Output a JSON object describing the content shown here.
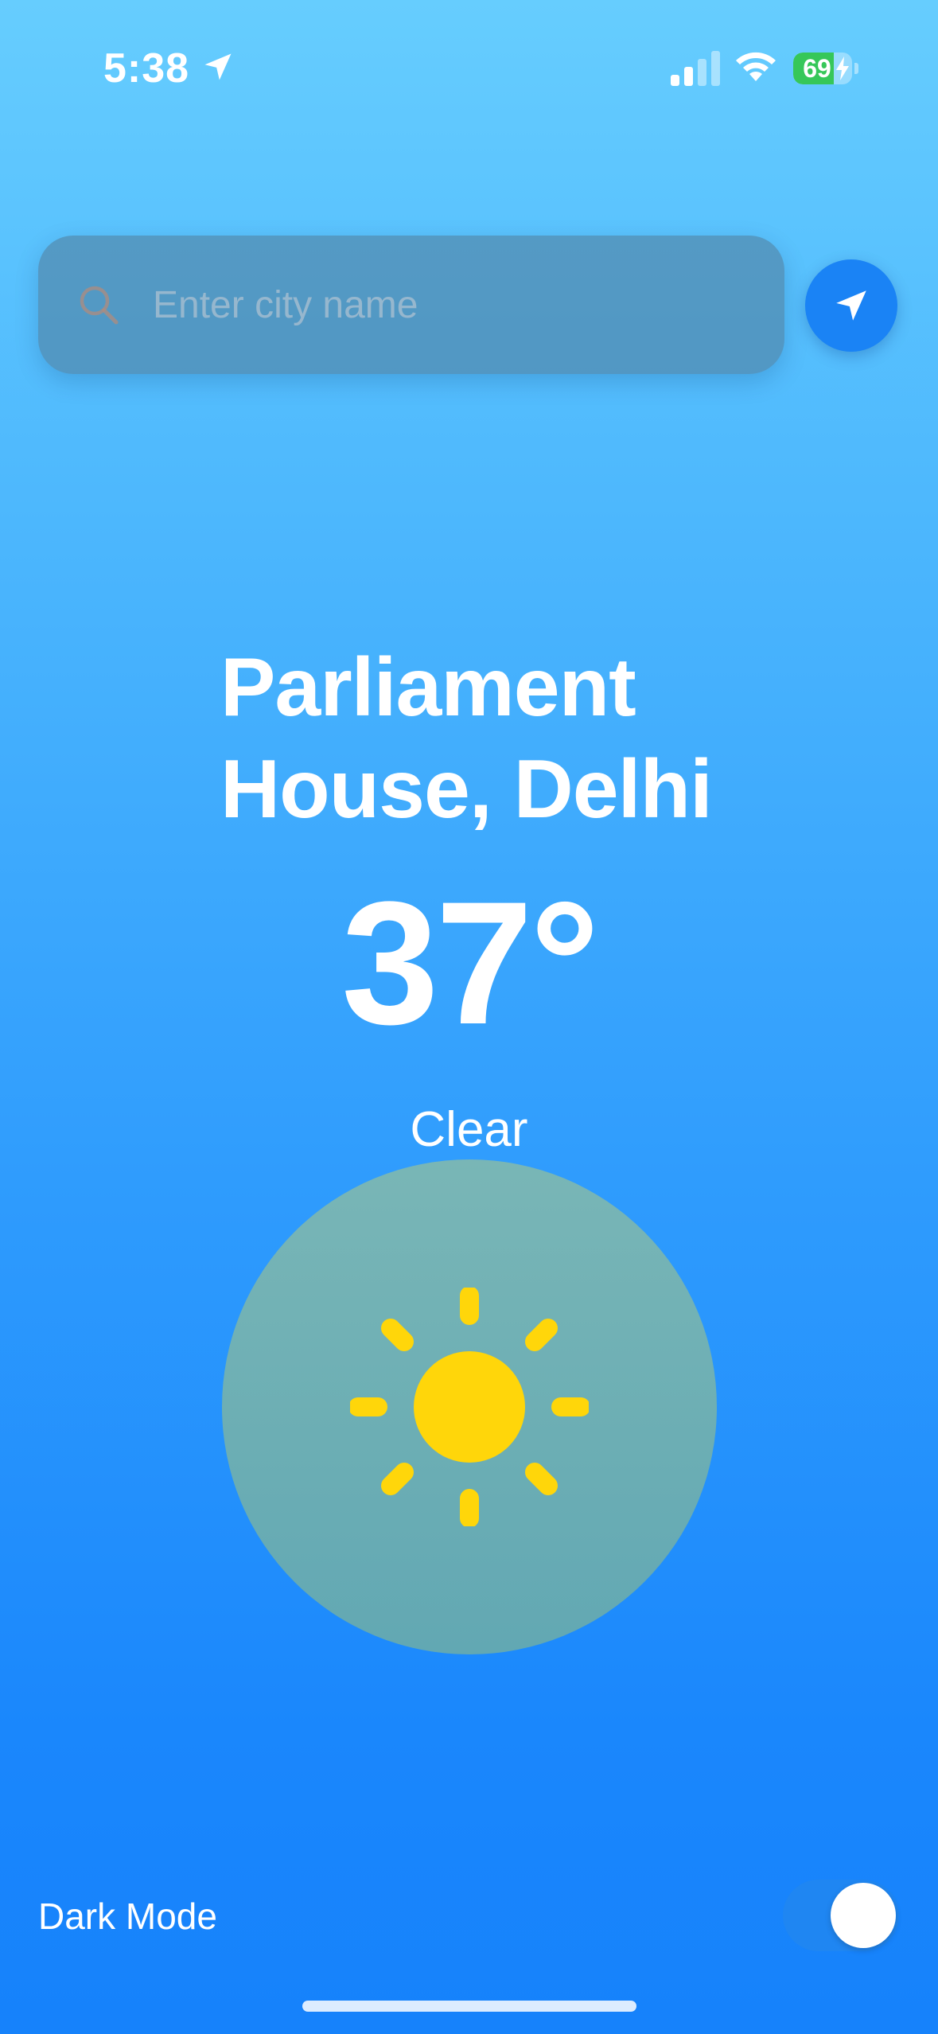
{
  "status_bar": {
    "time": "5:38",
    "location_indicator": "location-arrow-icon",
    "signal": "signal-bars-icon",
    "wifi": "wifi-icon",
    "battery_level": 69,
    "battery_label": "69",
    "charging": true
  },
  "search": {
    "placeholder": "Enter city name",
    "value": "",
    "icon": "search-icon"
  },
  "locate_button": {
    "icon": "location-arrow-icon",
    "color": "#1a83f5"
  },
  "weather": {
    "location_line1": "Parliament",
    "location_line2": "House, Delhi",
    "temperature": "37°",
    "condition": "Clear",
    "condition_icon": "sun-icon",
    "sun_color": "#ffd60a"
  },
  "settings": {
    "dark_mode_label": "Dark Mode",
    "dark_mode_on": false
  },
  "colors": {
    "background_top": "#66cdfe",
    "background_bottom": "#1682fb",
    "battery_green": "#36c759"
  }
}
